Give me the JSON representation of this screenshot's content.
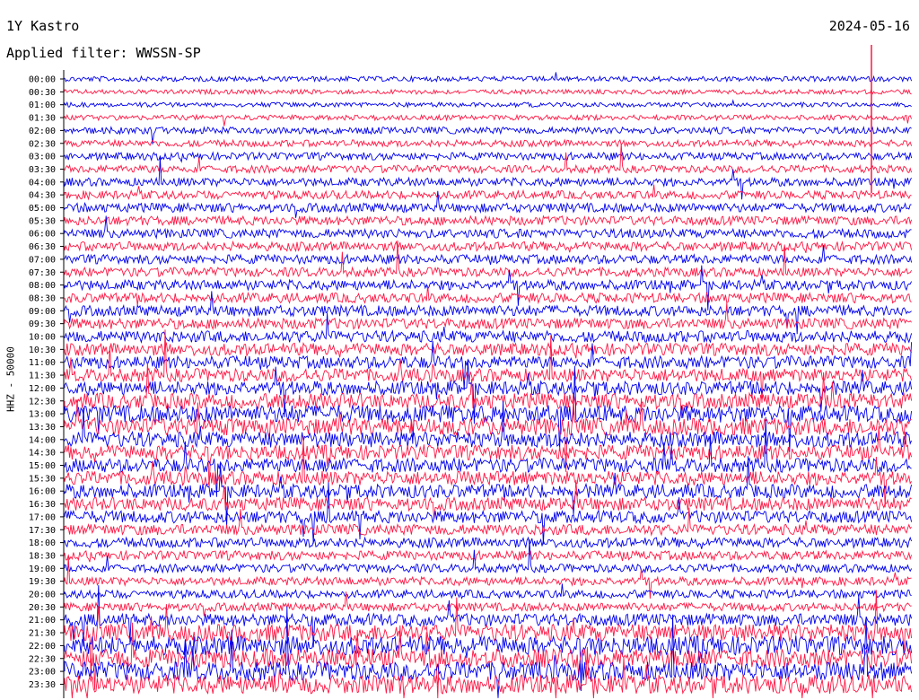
{
  "header": {
    "station": "1Y Kastro",
    "date": "2024-05-16",
    "filter": "Applied filter: WWSSN-SP"
  },
  "chart_data": {
    "type": "line",
    "title": "1Y Kastro",
    "date": "2024-05-16",
    "filter": "WWSSN-SP",
    "ylabel": "HHZ - 50000",
    "trace_colors": [
      "#0000ee",
      "#ff1744"
    ],
    "rows": [
      "00:00",
      "00:30",
      "01:00",
      "01:30",
      "02:00",
      "02:30",
      "03:00",
      "03:30",
      "04:00",
      "04:30",
      "05:00",
      "05:30",
      "06:00",
      "06:30",
      "07:00",
      "07:30",
      "08:00",
      "08:30",
      "09:00",
      "09:30",
      "10:00",
      "10:30",
      "11:00",
      "11:30",
      "12:00",
      "12:30",
      "13:00",
      "13:30",
      "14:00",
      "14:30",
      "15:00",
      "15:30",
      "16:00",
      "16:30",
      "17:00",
      "17:30",
      "18:00",
      "18:30",
      "19:00",
      "19:30",
      "20:00",
      "20:30",
      "21:00",
      "21:30",
      "22:00",
      "22:30",
      "23:00",
      "23:30"
    ],
    "noise_level": [
      0.15,
      0.12,
      0.12,
      0.15,
      0.25,
      0.25,
      0.3,
      0.3,
      0.35,
      0.35,
      0.4,
      0.4,
      0.4,
      0.4,
      0.4,
      0.4,
      0.45,
      0.45,
      0.5,
      0.5,
      0.55,
      0.6,
      0.6,
      0.65,
      0.7,
      0.8,
      0.9,
      0.9,
      0.8,
      0.75,
      0.7,
      0.7,
      0.7,
      0.65,
      0.6,
      0.5,
      0.45,
      0.4,
      0.35,
      0.35,
      0.35,
      0.35,
      0.6,
      0.9,
      1.0,
      1.0,
      1.0,
      1.0
    ]
  }
}
